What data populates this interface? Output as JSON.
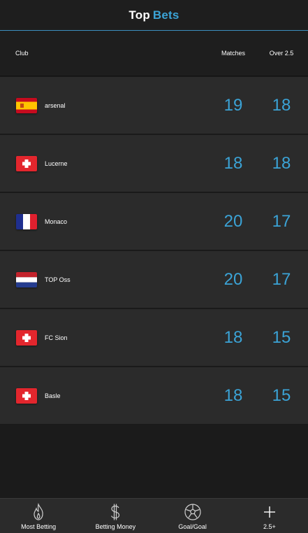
{
  "header": {
    "title_main": "Top",
    "title_accent": "Bets",
    "accent_color": "#3ba3d6"
  },
  "columns": {
    "club": "Club",
    "matches": "Matches",
    "over": "Over 2.5"
  },
  "rows": [
    {
      "club": "arsenal",
      "flag": "spain-flag",
      "matches": "19",
      "over": "18"
    },
    {
      "club": "Lucerne",
      "flag": "switzerland-flag",
      "matches": "18",
      "over": "18"
    },
    {
      "club": "Monaco",
      "flag": "france-flag",
      "matches": "20",
      "over": "17"
    },
    {
      "club": "TOP Oss",
      "flag": "netherlands-flag",
      "matches": "20",
      "over": "17"
    },
    {
      "club": "FC Sion",
      "flag": "switzerland-flag",
      "matches": "18",
      "over": "15"
    },
    {
      "club": "Basle",
      "flag": "switzerland-flag",
      "matches": "18",
      "over": "15"
    }
  ],
  "nav": [
    {
      "label": "Most Betting",
      "icon": "flame-icon"
    },
    {
      "label": "Betting Money",
      "icon": "dollar-icon"
    },
    {
      "label": "Goal/Goal",
      "icon": "soccer-ball-icon"
    },
    {
      "label": "2.5+",
      "icon": "plus-icon"
    }
  ]
}
